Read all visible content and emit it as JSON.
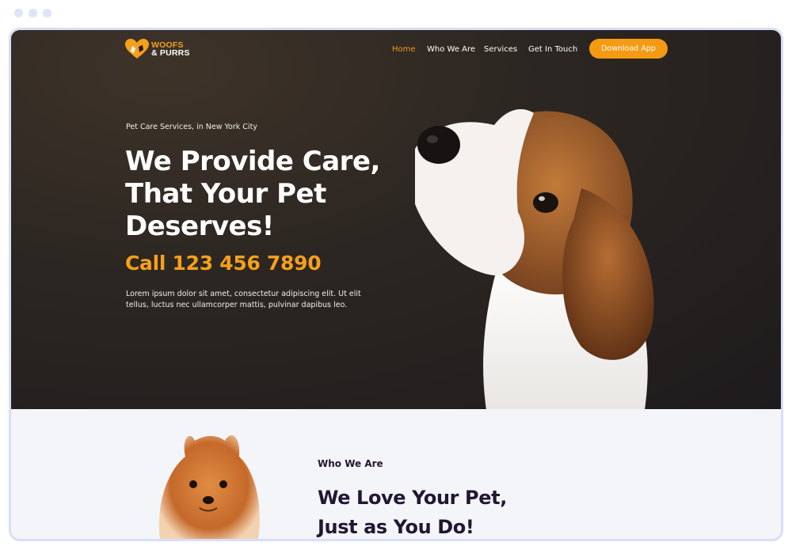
{
  "brand": {
    "line1": "WOOFS",
    "line2": "& PURRS",
    "accent": "#f49b16"
  },
  "nav": {
    "items": [
      {
        "label": "Home",
        "active": true
      },
      {
        "label": "Who We Are",
        "active": false
      },
      {
        "label": "Services",
        "active": false
      },
      {
        "label": "Get In Touch",
        "active": false
      }
    ],
    "cta_label": "Download App"
  },
  "hero": {
    "eyebrow": "Pet Care Services, in New York City",
    "headline_lines": [
      "We Provide Care,",
      "That Your Pet",
      "Deserves!"
    ],
    "phone": "Call 123 456 7890",
    "description": "Lorem ipsum dolor sit amet, consectetur adipiscing elit. Ut elit tellus, luctus nec ullamcorper mattis, pulvinar dapibus leo."
  },
  "about": {
    "eyebrow": "Who We Are",
    "title_lines": [
      "We Love Your Pet,",
      "Just as You Do!"
    ]
  },
  "colors": {
    "orange": "#f59a13",
    "dark": "#221733",
    "hero_bg": "#2b2522"
  }
}
